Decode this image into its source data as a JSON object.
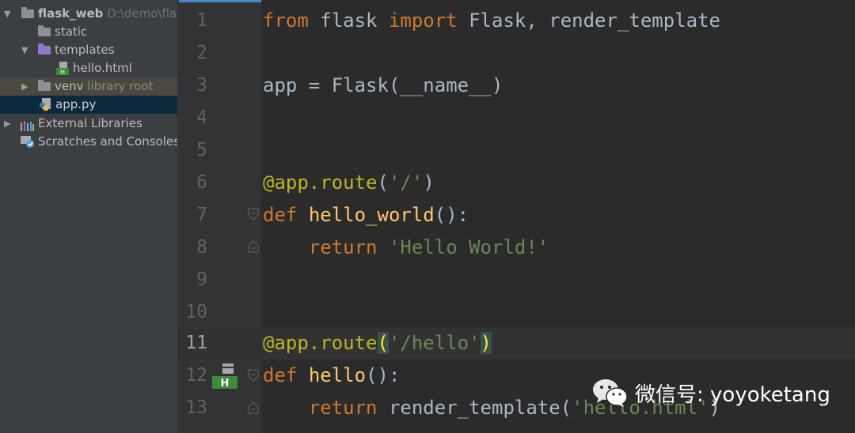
{
  "project_tree": {
    "root": {
      "label": "flask_web",
      "path": "D:\\demo\\flask_web"
    },
    "items": [
      {
        "label": "static"
      },
      {
        "label": "templates"
      },
      {
        "label": "hello.html"
      },
      {
        "label": "venv",
        "hint": "library root"
      },
      {
        "label": "app.py"
      },
      {
        "label": "External Libraries"
      },
      {
        "label": "Scratches and Consoles"
      }
    ]
  },
  "editor": {
    "current_line": 11,
    "line_numbers": [
      "1",
      "2",
      "3",
      "4",
      "5",
      "6",
      "7",
      "8",
      "9",
      "10",
      "11",
      "12",
      "13"
    ],
    "lines": {
      "l1": {
        "kw1": "from",
        "mod": " flask ",
        "kw2": "import",
        "rest": " Flask, render_template"
      },
      "l3": {
        "text": "app = Flask(__name__)"
      },
      "l6": {
        "dec": "@app.route",
        "open": "(",
        "str": "'/'",
        "close": ")"
      },
      "l7": {
        "kw": "def",
        "sp": " ",
        "fn": "hello_world",
        "rest": "():"
      },
      "l8": {
        "indent": "    ",
        "kw": "return",
        "sp": " ",
        "str": "'Hello World!'"
      },
      "l11": {
        "dec": "@app.route",
        "open": "(",
        "str": "'/hello'",
        "close": ")"
      },
      "l12": {
        "kw": "def",
        "sp": " ",
        "fn": "hello",
        "rest": "():"
      },
      "l13": {
        "indent": "    ",
        "kw": "return",
        "mid": " render_template(",
        "str": "'hello.html'",
        "close": ")"
      }
    }
  },
  "watermark": {
    "text": "微信号: yoyoketang"
  },
  "colors": {
    "keyword": "#cc7832",
    "string": "#6a8759",
    "decorator": "#bbb529",
    "function": "#ffc66d",
    "text": "#a9b7c6",
    "selection": "#0d293e"
  }
}
